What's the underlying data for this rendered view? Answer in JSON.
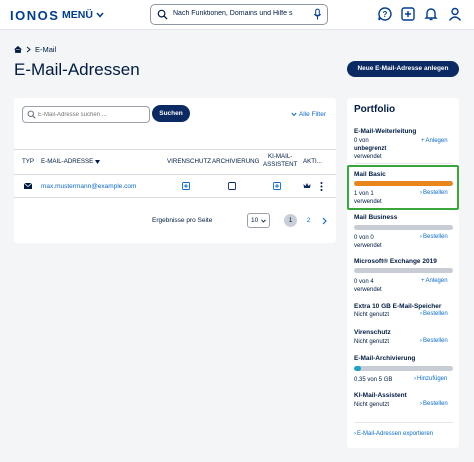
{
  "header": {
    "logo": "IONOS",
    "menu_label": "MENÜ",
    "search_text": "Nach Funktionen, Domains und Hilfe s"
  },
  "breadcrumb": {
    "item": "E-Mail"
  },
  "page": {
    "title": "E-Mail-Adressen",
    "new_button": "Neue E-Mail-Adresse anlegen"
  },
  "toolbar": {
    "search_placeholder": "E-Mail-Adresse suchen ...",
    "search_button": "Suchen",
    "filter_link": "Alle Filter"
  },
  "table": {
    "columns": [
      "TYP",
      "E-MAIL-ADRESSE",
      "VIRENSCHUTZ",
      "ARCHIVIERUNG",
      "KI-MAIL-",
      "ASSISTENT",
      "AKTI..."
    ],
    "rows": [
      {
        "email": "max.mustermann@example.com"
      }
    ]
  },
  "pagination": {
    "label": "Ergebnisse pro Seite",
    "per_page": "10",
    "pages": [
      "1",
      "2"
    ],
    "current": "1"
  },
  "portfolio": {
    "title": "Portfolio",
    "items": [
      {
        "name": "E-Mail-Weiterleitung",
        "line1": "0 von",
        "line1_bold": "unbegrenzt",
        "line2": "verwendet",
        "link": "Anlegen",
        "fill": 0
      },
      {
        "name": "Mail Basic",
        "line1": "1 von 1",
        "line2": "verwendet",
        "link": "Bestellen",
        "fill": 1.0,
        "fill_color": "#e8861c"
      },
      {
        "name": "Mail Business",
        "line1": "0 von 0",
        "line2": "verwendet",
        "link": "Bestellen",
        "fill": 0
      },
      {
        "name": "Microsoft® Exchange 2019",
        "line1": "0 von 4",
        "line2": "verwendet",
        "link": "Anlegen",
        "fill": 0
      },
      {
        "name": "Extra 10 GB E-Mail-Speicher",
        "line1": "Nicht genutzt",
        "link": "Bestellen"
      },
      {
        "name": "Virenschutz",
        "line1": "Nicht genutzt",
        "link": "Bestellen"
      },
      {
        "name": "E-Mail-Archivierung",
        "line1": "0.35 von 5 GB",
        "link": "Hinzufügen",
        "fill": 0.07,
        "fill_color": "#1aa3c8"
      },
      {
        "name": "KI-Mail-Assistent",
        "line1": "Nicht genutzt",
        "link": "Bestellen"
      }
    ],
    "export_link": "E-Mail-Adressen exportieren"
  }
}
